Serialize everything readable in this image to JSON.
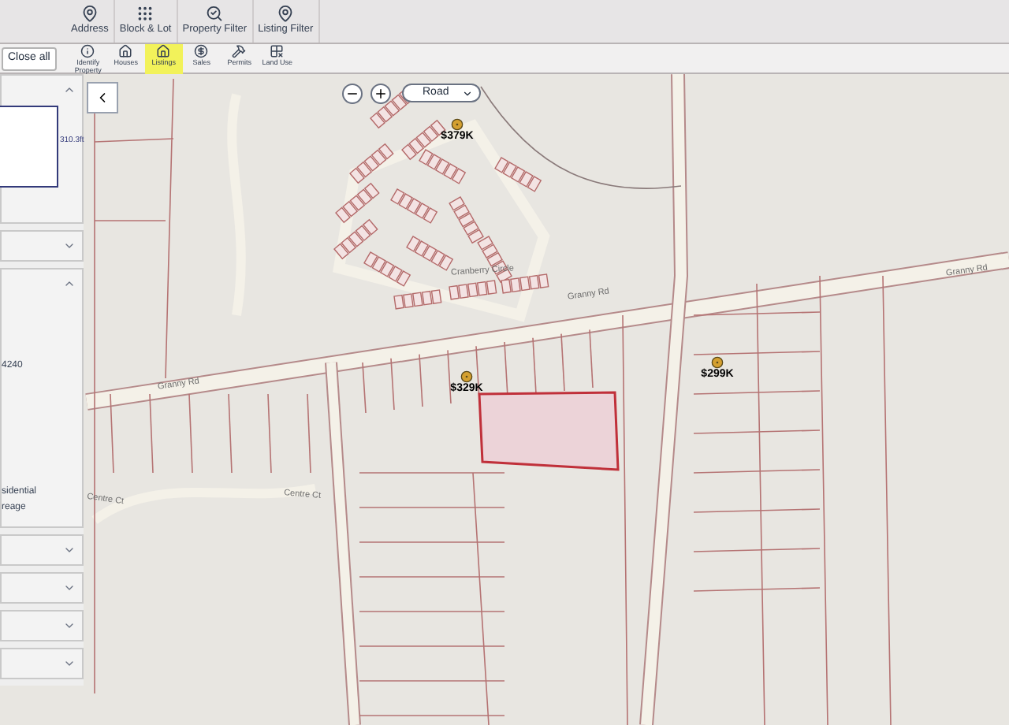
{
  "top_toolbar": [
    {
      "label": "Address",
      "kind": "pin"
    },
    {
      "label": "Block & Lot",
      "kind": "grid"
    },
    {
      "label": "Property Filter",
      "kind": "filter"
    },
    {
      "label": "Listing Filter",
      "kind": "pin"
    }
  ],
  "close_all": "Close all",
  "layer_toolbar": [
    {
      "label": "Identify Property",
      "kind": "identify",
      "selected": false
    },
    {
      "label": "Houses",
      "kind": "house",
      "selected": false
    },
    {
      "label": "Listings",
      "kind": "house",
      "selected": true
    },
    {
      "label": "Sales",
      "kind": "sales",
      "selected": false
    },
    {
      "label": "Permits",
      "kind": "permits",
      "selected": false
    },
    {
      "label": "Land Use",
      "kind": "landuse",
      "selected": false
    }
  ],
  "left_panel": {
    "sections": [
      {
        "expanded": true,
        "kind": "parcel",
        "texts": [
          "310.3ft"
        ]
      },
      {
        "expanded": false
      },
      {
        "expanded": true,
        "kind": "text",
        "texts": [
          "4240",
          "sidential",
          "reage"
        ]
      },
      {
        "expanded": false
      },
      {
        "expanded": false
      },
      {
        "expanded": false
      },
      {
        "expanded": false
      }
    ]
  },
  "map": {
    "layer_select": "Road",
    "price_markers": [
      {
        "label": "$379K"
      },
      {
        "label": "$329K"
      },
      {
        "label": "$299K"
      }
    ],
    "road_labels": [
      {
        "label": "Cranberry Circle"
      },
      {
        "label": "Granny Rd"
      },
      {
        "label": "Granny Rd"
      },
      {
        "label": "Granny Rd"
      },
      {
        "label": "Centre Ct"
      },
      {
        "label": "Centre Ct"
      }
    ]
  }
}
